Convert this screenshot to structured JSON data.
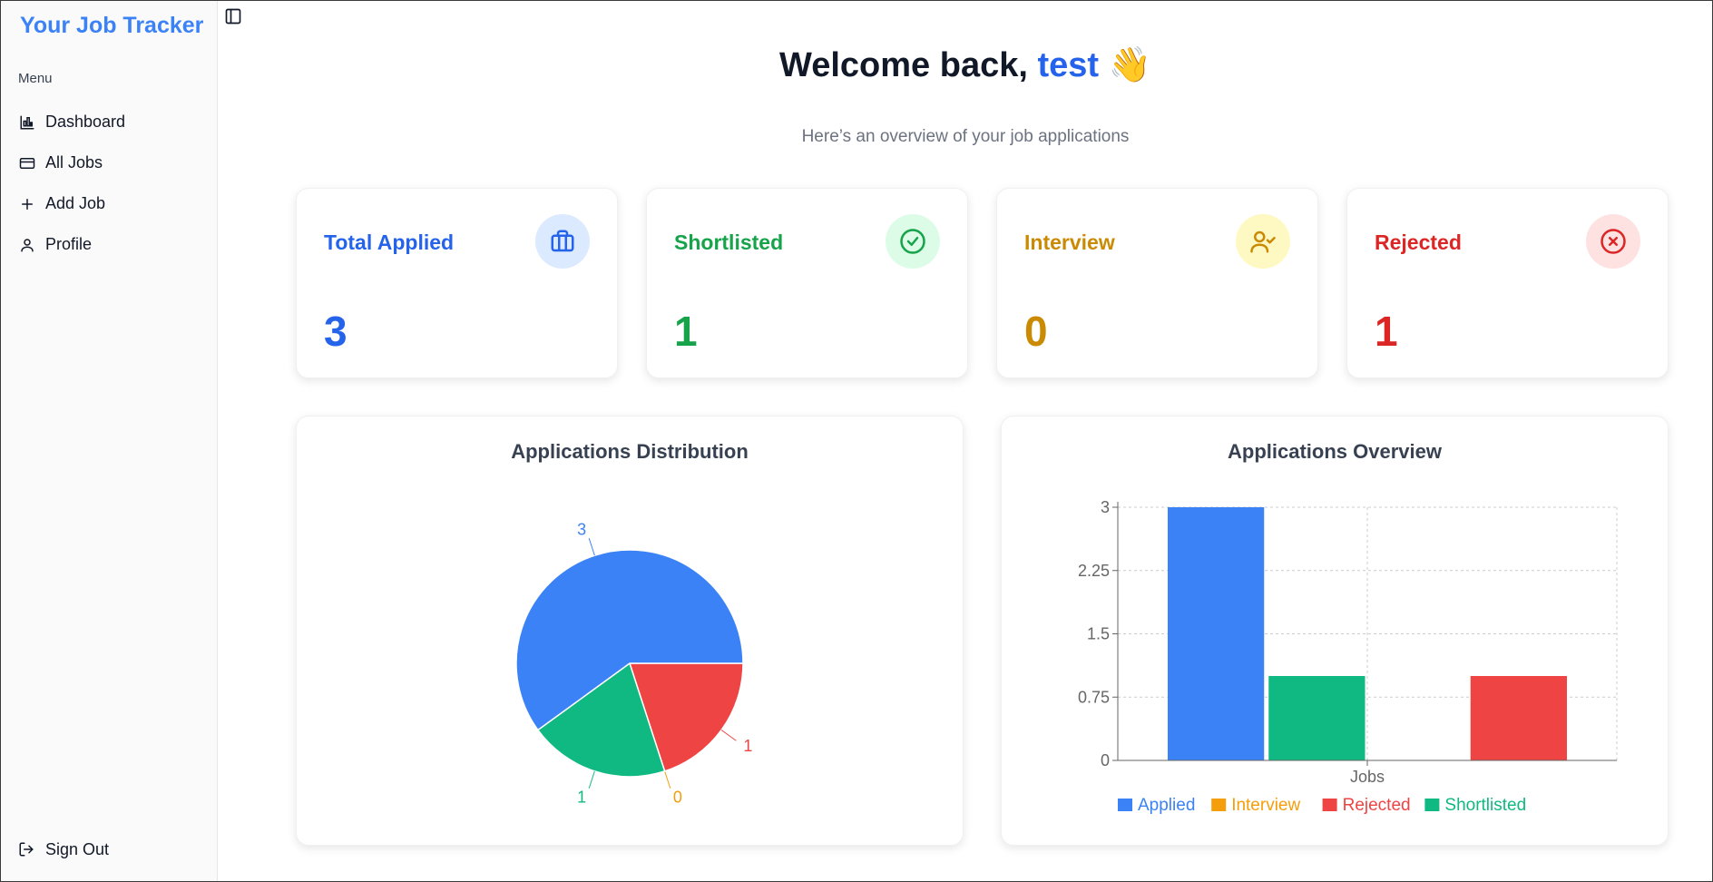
{
  "sidebar": {
    "brand": "Your Job Tracker",
    "menu_label": "Menu",
    "items": [
      {
        "label": "Dashboard",
        "icon": "bar-chart-icon"
      },
      {
        "label": "All Jobs",
        "icon": "credit-card-icon"
      },
      {
        "label": "Add Job",
        "icon": "plus-icon"
      },
      {
        "label": "Profile",
        "icon": "user-icon"
      }
    ],
    "signout": "Sign Out"
  },
  "header": {
    "greeting": "Welcome back,",
    "username": "test",
    "emoji": "👋",
    "subtitle": "Here’s an overview of your job applications"
  },
  "stats": [
    {
      "label": "Total Applied",
      "value": "3",
      "color": "#2563eb",
      "bg": "#dbeafe",
      "icon": "briefcase-icon"
    },
    {
      "label": "Shortlisted",
      "value": "1",
      "color": "#16a34a",
      "bg": "#dcfce7",
      "icon": "check-circle-icon"
    },
    {
      "label": "Interview",
      "value": "0",
      "color": "#ca8a04",
      "bg": "#fef9c3",
      "icon": "user-check-icon"
    },
    {
      "label": "Rejected",
      "value": "1",
      "color": "#dc2626",
      "bg": "#fee2e2",
      "icon": "x-circle-icon"
    }
  ],
  "chart_data": [
    {
      "type": "pie",
      "title": "Applications Distribution",
      "slices": [
        {
          "name": "Applied",
          "value": 3,
          "color": "#3b82f6",
          "label": "3"
        },
        {
          "name": "Rejected",
          "value": 1,
          "color": "#ef4444",
          "label": "1"
        },
        {
          "name": "Interview",
          "value": 0,
          "color": "#f59e0b",
          "label": "0"
        },
        {
          "name": "Shortlisted",
          "value": 1,
          "color": "#10b981",
          "label": "1"
        }
      ]
    },
    {
      "type": "bar",
      "title": "Applications Overview",
      "categories": [
        "Jobs"
      ],
      "series": [
        {
          "name": "Applied",
          "values": [
            3
          ],
          "color": "#3b82f6"
        },
        {
          "name": "Shortlisted",
          "values": [
            1
          ],
          "color": "#10b981"
        },
        {
          "name": "Interview",
          "values": [
            0
          ],
          "color": "#f59e0b"
        },
        {
          "name": "Rejected",
          "values": [
            1
          ],
          "color": "#ef4444"
        }
      ],
      "legend_order": [
        "Applied",
        "Interview",
        "Rejected",
        "Shortlisted"
      ],
      "yticks": [
        "0",
        "0.75",
        "1.5",
        "2.25",
        "3"
      ],
      "ylim": [
        0,
        3
      ],
      "grid": true,
      "legend": "bottom"
    }
  ]
}
